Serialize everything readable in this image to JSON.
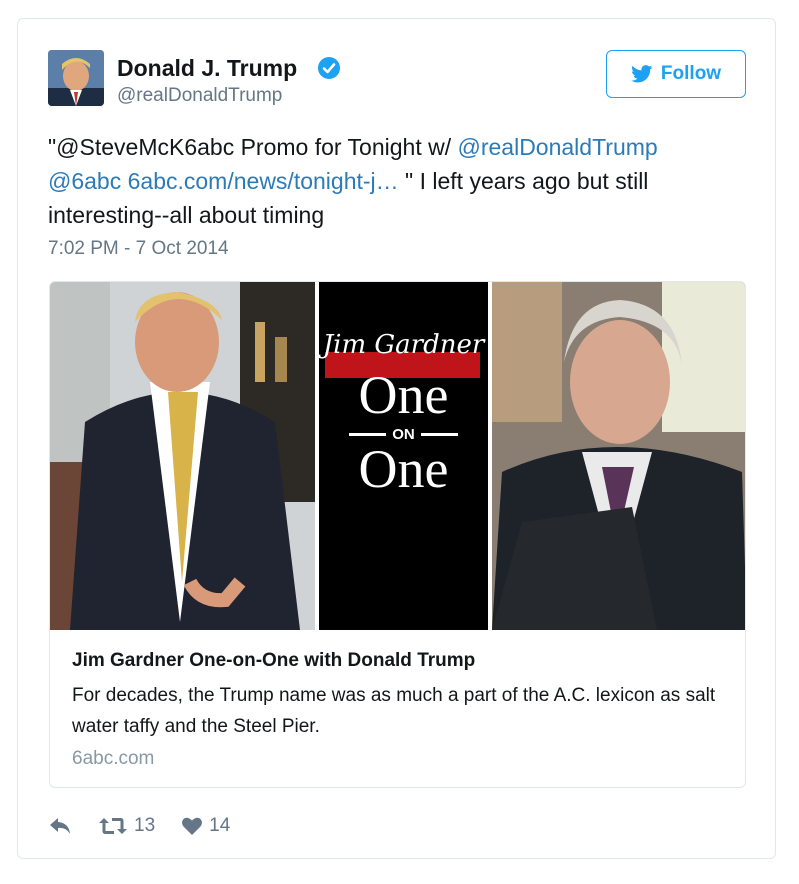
{
  "author": {
    "name": "Donald J. Trump",
    "handle": "@realDonaldTrump"
  },
  "follow_label": "Follow",
  "tweet": {
    "prefix": "\"@SteveMcK6abc Promo for Tonight w/ ",
    "mention1": "@realDonaldTrump",
    "mention2": "@6abc",
    "link": "6abc.com/news/tonight-j…",
    "suffix": " \" I left years ago but still interesting--all about timing",
    "timestamp": "7:02 PM - 7 Oct 2014"
  },
  "link_card": {
    "logo_script": "Jim Gardner",
    "logo_top": "One",
    "logo_mid": "ON",
    "logo_bottom": "One",
    "title": "Jim Gardner One-on-One with Donald Trump",
    "description": "For decades, the Trump name was as much a part of the A.C. lexicon as salt water taffy and the Steel Pier.",
    "domain": "6abc.com"
  },
  "actions": {
    "retweets": "13",
    "likes": "14"
  },
  "colors": {
    "link": "#2b7bb9",
    "follow": "#1da1f2",
    "verified": "#1da1f2"
  }
}
